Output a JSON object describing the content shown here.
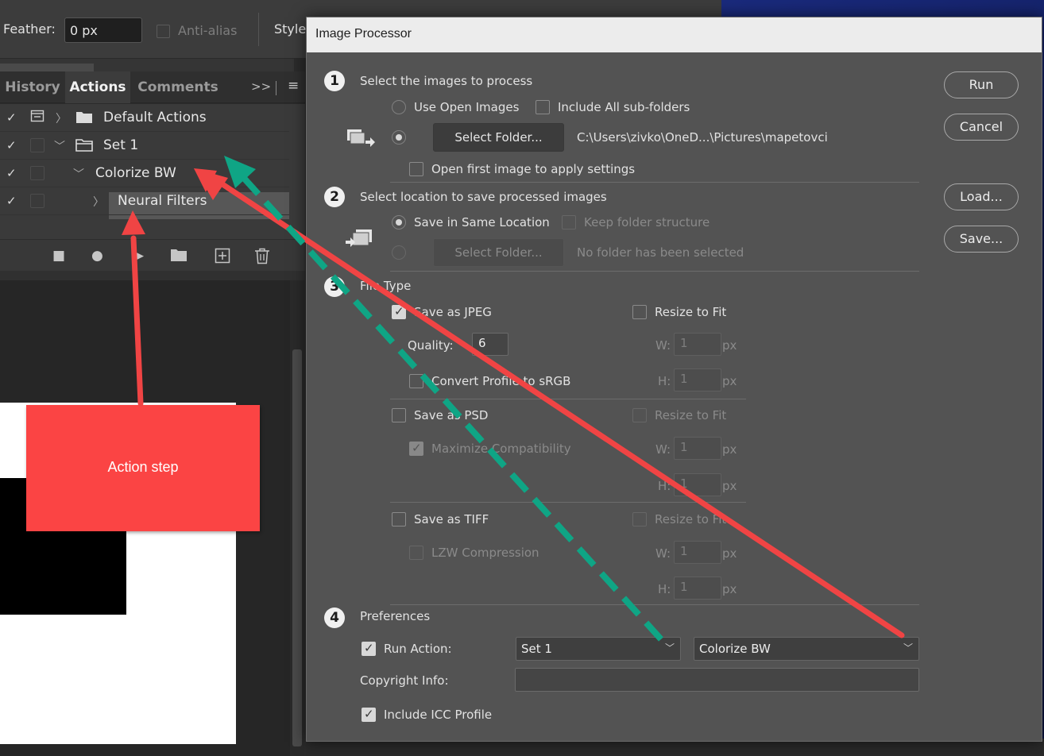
{
  "options_bar": {
    "feather_label": "Feather:",
    "feather_value": "0 px",
    "anti_alias_label": "Anti-alias",
    "style_label": "Style"
  },
  "panel": {
    "tabs": [
      "History",
      "Actions",
      "Comments"
    ],
    "expand_glyph": ">>",
    "menu_glyph": "≡",
    "rows": [
      {
        "label": "Default Actions",
        "check": "✓"
      },
      {
        "label": "Set 1",
        "check": "✓"
      },
      {
        "label": "Colorize BW",
        "check": "✓"
      },
      {
        "label": "Neural Filters",
        "check": "✓"
      }
    ]
  },
  "callout": {
    "text": "Action step",
    "color": "#fb4444"
  },
  "dialog": {
    "title": "Image Processor",
    "buttons": {
      "run": "Run",
      "cancel": "Cancel",
      "load": "Load...",
      "save": "Save..."
    },
    "section1": {
      "number": "1",
      "title": "Select the images to process",
      "use_open_images": "Use Open Images",
      "include_subfolders": "Include All sub-folders",
      "select_folder_button": "Select Folder...",
      "folder_path": "C:\\Users\\zivko\\OneD...\\Pictures\\mapetovci",
      "open_first_image": "Open first image to apply settings"
    },
    "section2": {
      "number": "2",
      "title": "Select location to save processed images",
      "save_same_location": "Save in Same Location",
      "keep_folder_structure": "Keep folder structure",
      "select_folder_button": "Select Folder...",
      "no_folder": "No folder has been selected"
    },
    "section3": {
      "number": "3",
      "title": "File Type",
      "save_jpeg": "Save as JPEG",
      "quality_label": "Quality:",
      "quality_value": "6",
      "convert_profile": "Convert Profile to sRGB",
      "save_psd": "Save as PSD",
      "maximize_compat": "Maximize Compatibility",
      "save_tiff": "Save as TIFF",
      "lzw": "LZW Compression",
      "resize_to_fit": "Resize to Fit",
      "w_label": "W:",
      "h_label": "H:",
      "dim_value": "1",
      "unit": "px"
    },
    "section4": {
      "number": "4",
      "title": "Preferences",
      "run_action_label": "Run Action:",
      "set_value": "Set 1",
      "action_value": "Colorize BW",
      "copyright_label": "Copyright Info:",
      "copyright_value": "",
      "include_icc": "Include ICC Profile"
    }
  },
  "annotation_colors": {
    "arrow_red": "#f04444",
    "arrow_green": "#0fa585"
  }
}
